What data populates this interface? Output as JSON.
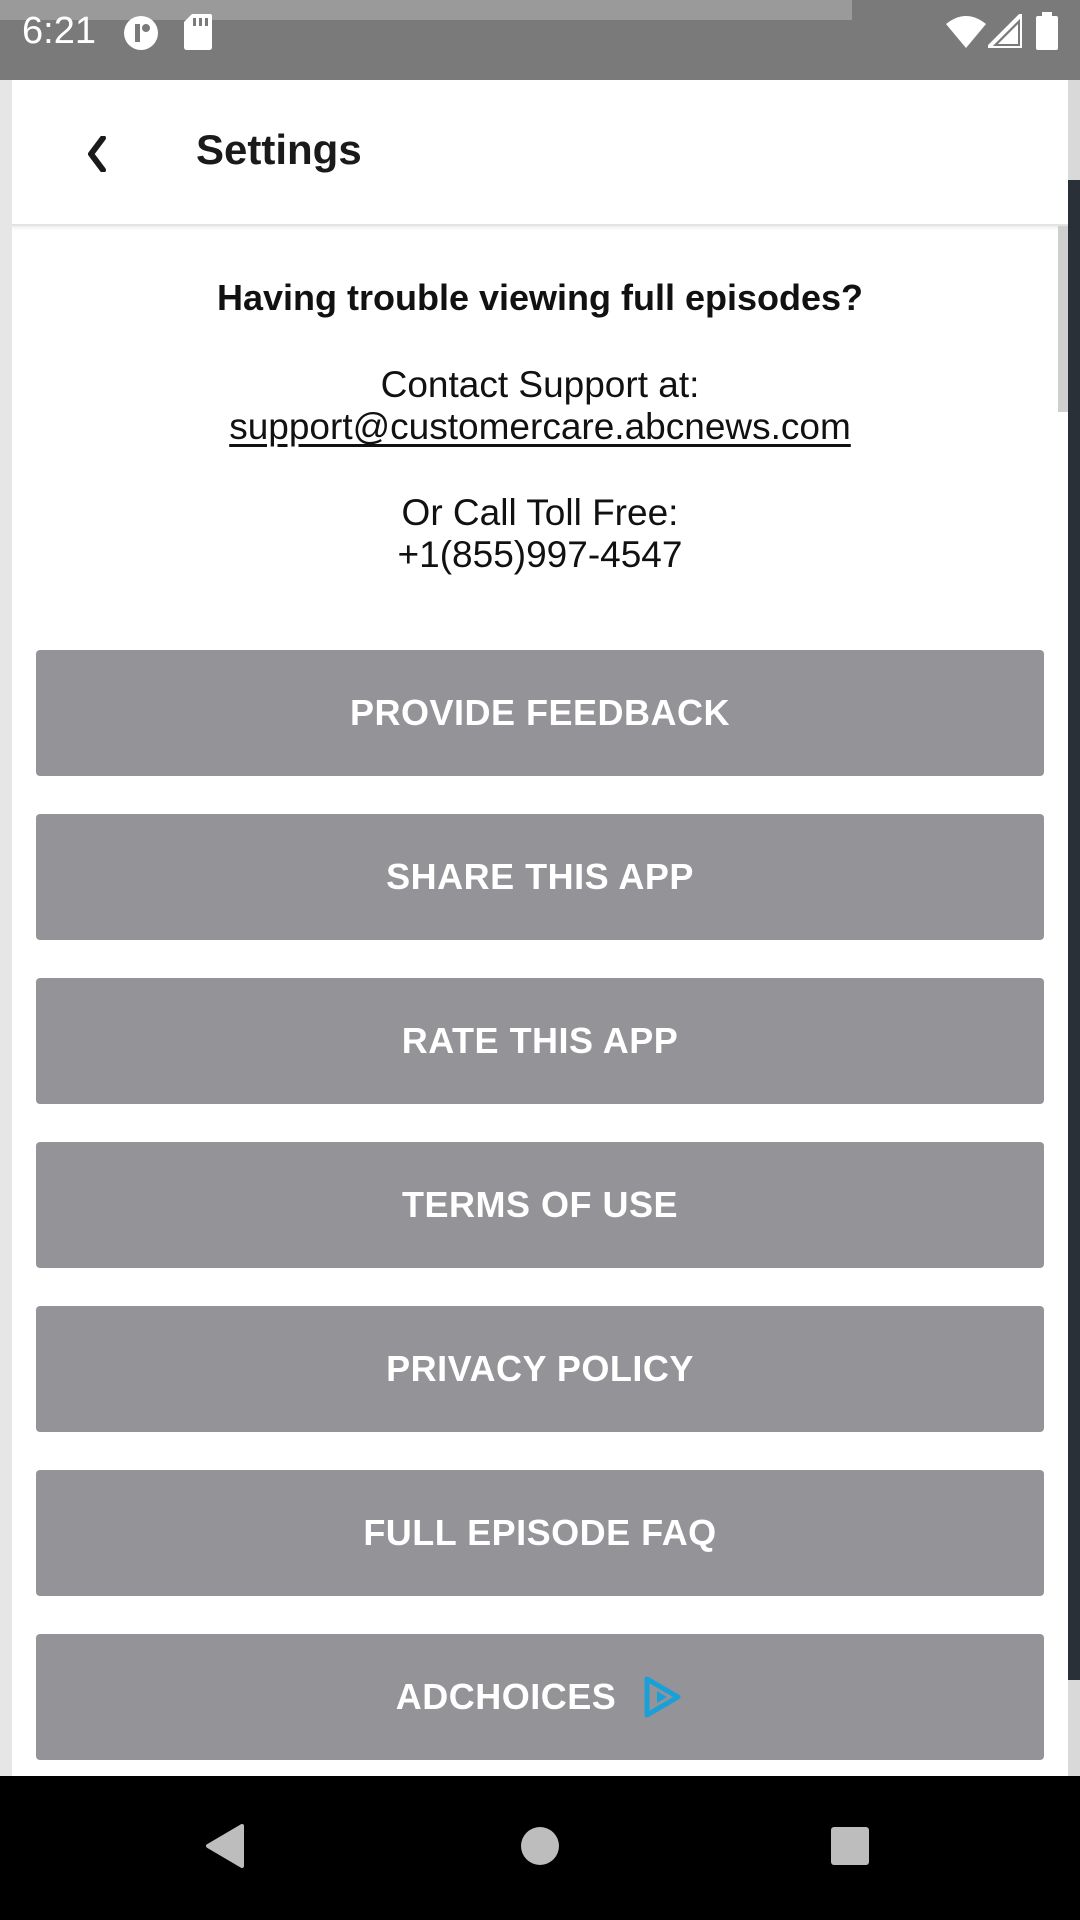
{
  "status_bar": {
    "time": "6:21",
    "icons": [
      "app-notification-icon",
      "sd-card-icon",
      "wifi-icon",
      "signal-icon",
      "battery-icon"
    ]
  },
  "header": {
    "title": "Settings",
    "back_icon": "chevron-left-icon"
  },
  "support": {
    "heading": "Having trouble viewing full episodes?",
    "contact_label": "Contact Support at:",
    "email": "support@customercare.abcnews.com",
    "call_label": "Or Call Toll Free:",
    "phone": "+1(855)997-4547"
  },
  "actions": [
    {
      "label": "PROVIDE FEEDBACK"
    },
    {
      "label": "SHARE THIS APP"
    },
    {
      "label": "RATE THIS APP"
    },
    {
      "label": "TERMS OF USE"
    },
    {
      "label": "PRIVACY POLICY"
    },
    {
      "label": "FULL EPISODE FAQ"
    },
    {
      "label": "ADCHOICES",
      "icon": "adchoices-icon"
    }
  ],
  "nav_bar": {
    "icons": [
      "back-triangle-icon",
      "home-circle-icon",
      "recents-square-icon"
    ]
  },
  "colors": {
    "button_bg": "#939398",
    "button_text": "#ffffff",
    "adchoices_accent": "#1aa0d8",
    "status_bar_bg": "#7a7a7a",
    "nav_bar_bg": "#000000"
  }
}
